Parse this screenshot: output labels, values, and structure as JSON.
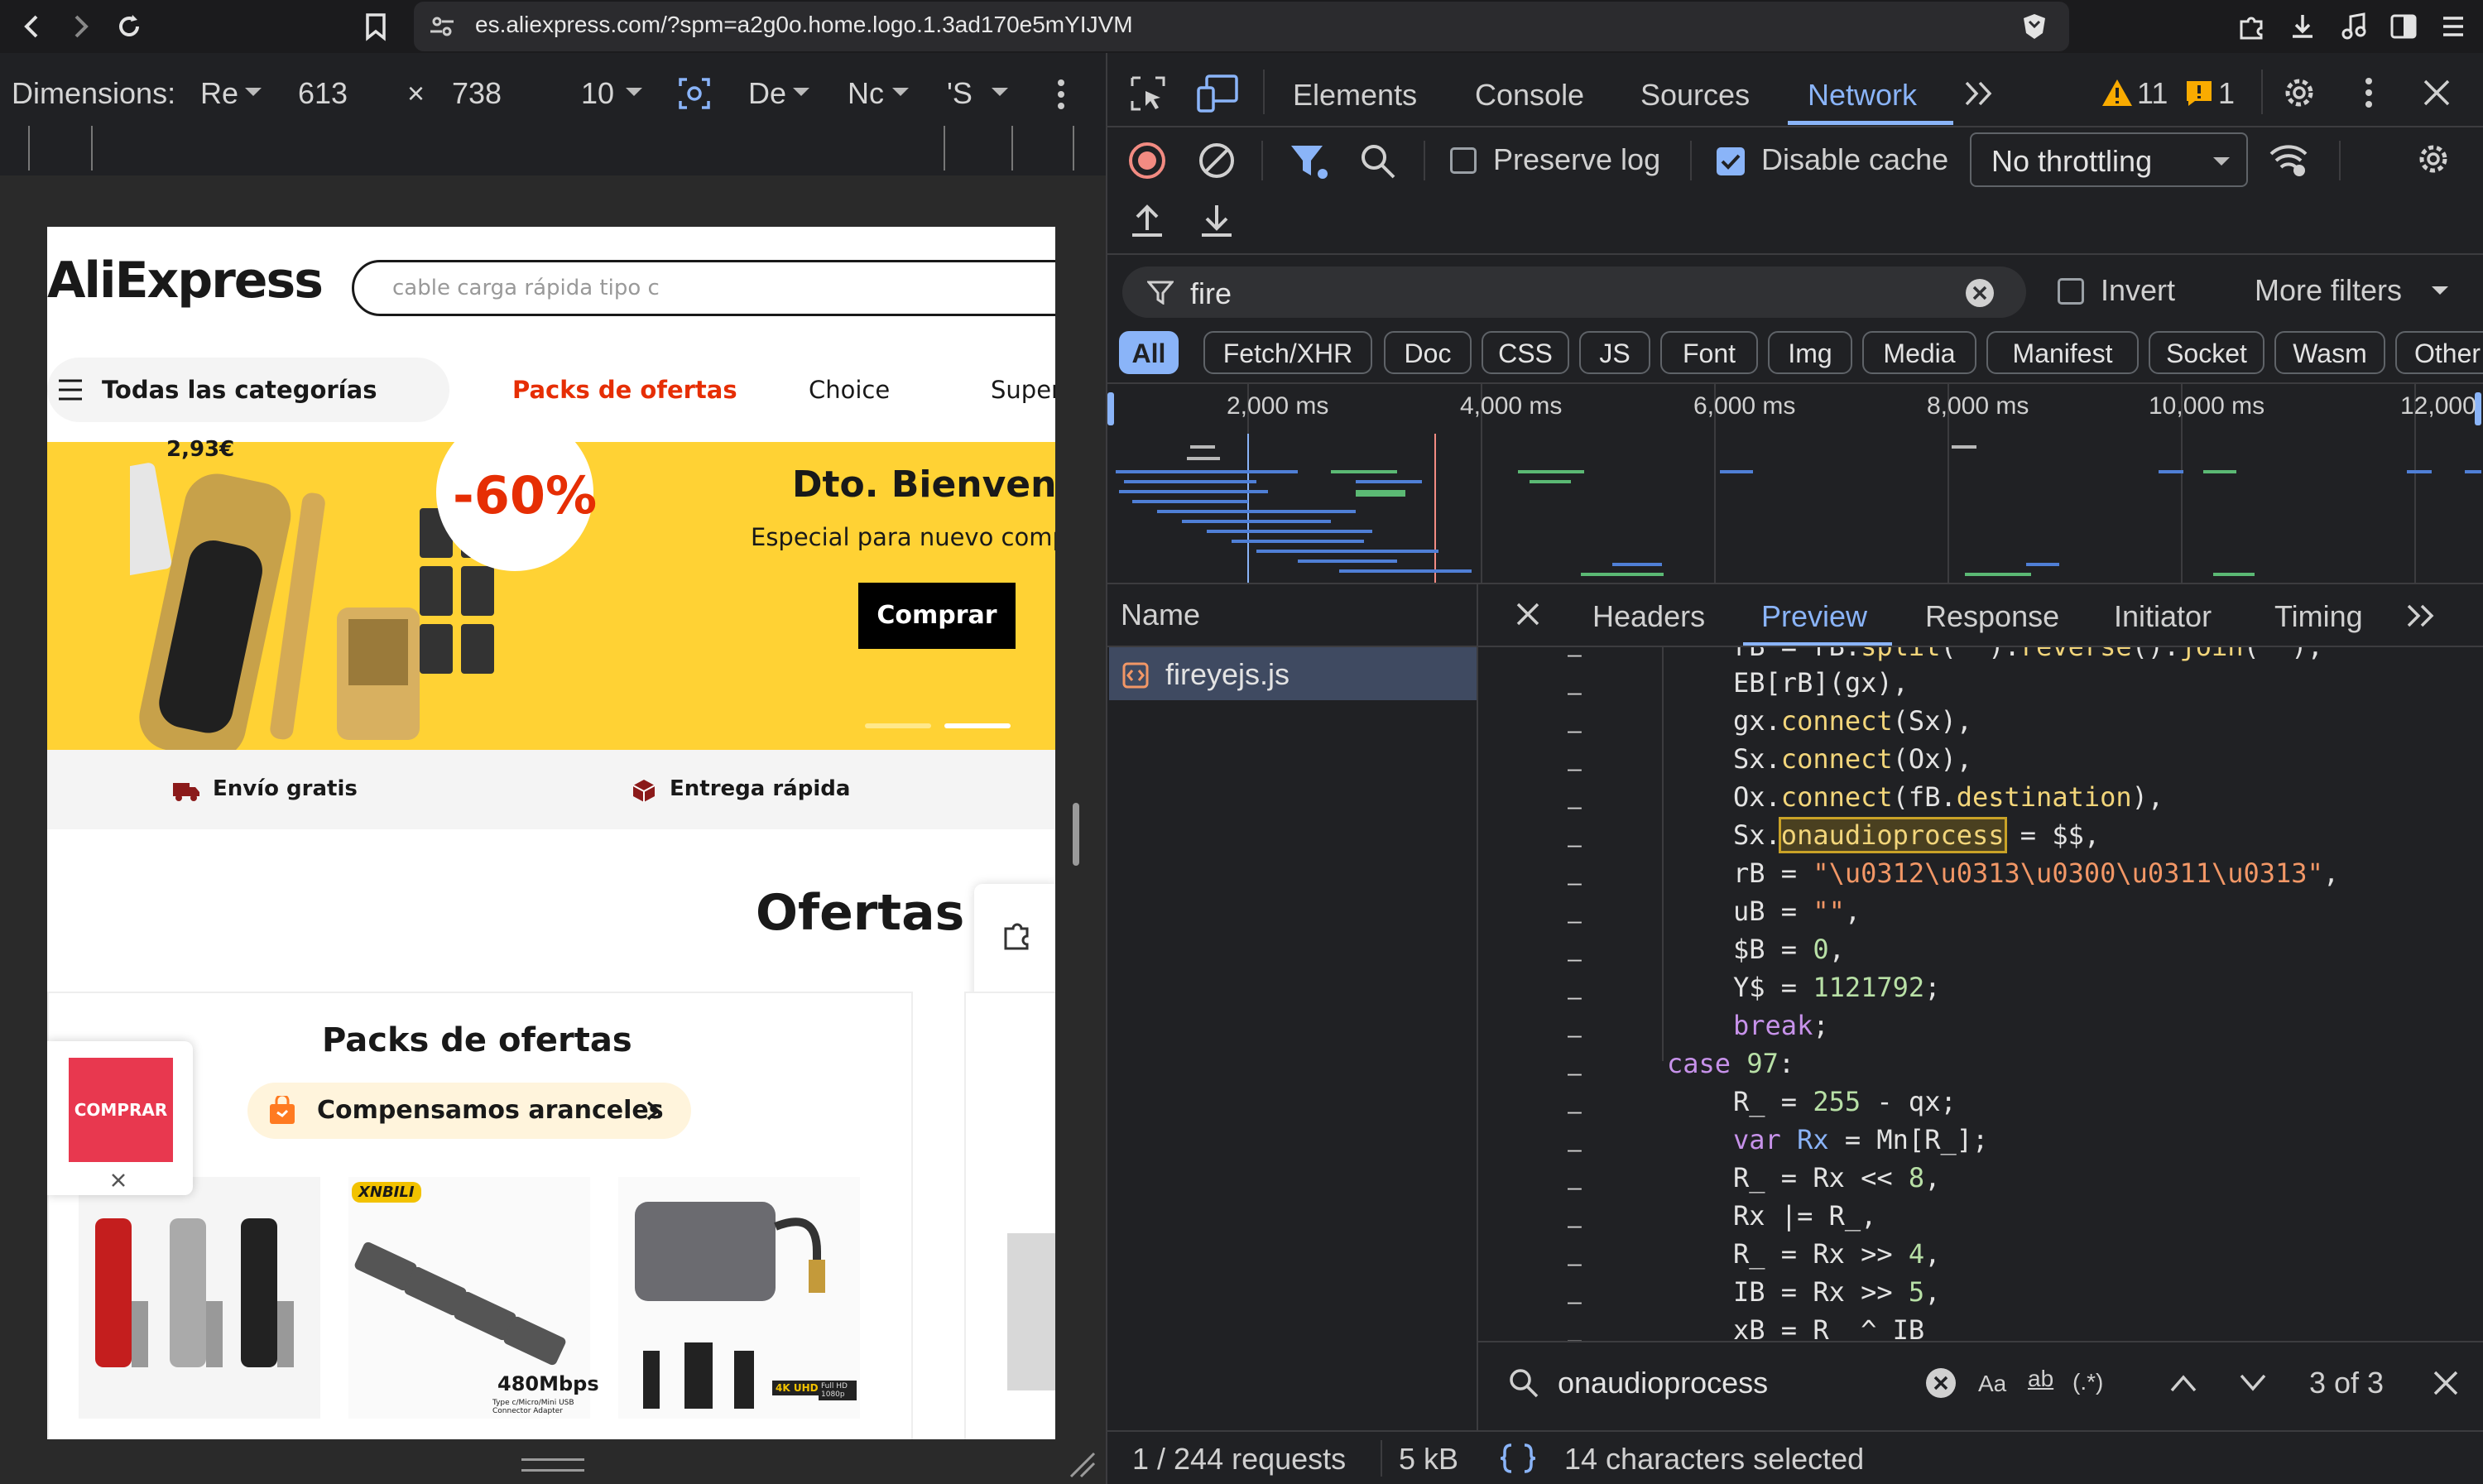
{
  "browser": {
    "url": "es.aliexpress.com/?spm=a2g0o.home.logo.1.3ad170e5mYIJVM"
  },
  "device_toolbar": {
    "dimensions_label": "Dimensions:",
    "device": "Re",
    "width": "613",
    "times": "×",
    "height": "738",
    "zoom": "10",
    "dpr": "De",
    "network": "Nc",
    "ua": "'S"
  },
  "page": {
    "logo": "AliExpress",
    "search_placeholder": "cable carga rápida tipo c",
    "nav_all_categories": "Todas las categorías",
    "nav_packs": "Packs de ofertas",
    "nav_choice": "Choice",
    "nav_super": "Super",
    "banner_price": "2,93€",
    "banner_discount": "-60%",
    "banner_title": "Dto. Bienvenic",
    "banner_subtitle": "Especial para nuevo comp",
    "banner_button": "Comprar",
    "envio_gratis": "Envío gratis",
    "entrega_rapida": "Entrega rápida",
    "section_title": "Ofertas d",
    "card_title": "Packs de ofertas",
    "card_badge": "Compensamos aranceles",
    "floating_buy": "COMPRAR",
    "product2_brand": "XNBILI",
    "product2_speed": "480Mbps",
    "product2_caption": "Type c/Micro/Mini USB Connector Adapter",
    "product3_badge1": "4K UHD",
    "product3_badge2": "Full HD 1080p"
  },
  "devtools": {
    "tabs": [
      "Elements",
      "Console",
      "Sources",
      "Network"
    ],
    "active_tab": "Network",
    "warnings": "11",
    "issues": "1",
    "preserve_log": "Preserve log",
    "disable_cache": "Disable cache",
    "throttling": "No throttling",
    "filter_value": "fire",
    "invert": "Invert",
    "more_filters": "More filters",
    "type_filters": [
      "All",
      "Fetch/XHR",
      "Doc",
      "CSS",
      "JS",
      "Font",
      "Img",
      "Media",
      "Manifest",
      "Socket",
      "Wasm",
      "Other"
    ],
    "timeline_ticks": [
      "2,000 ms",
      "4,000 ms",
      "6,000 ms",
      "8,000 ms",
      "10,000 ms",
      "12,000"
    ],
    "name_header": "Name",
    "request_name": "fireyejs.js",
    "detail_tabs": [
      "Headers",
      "Preview",
      "Response",
      "Initiator",
      "Timing"
    ],
    "active_detail_tab": "Preview",
    "search_query": "onaudioprocess",
    "search_case": "Aa",
    "search_word": "ab",
    "search_regex": "(.*)",
    "search_count": "3 of 3",
    "status_requests": "1 / 244 requests",
    "status_size": "5 kB",
    "status_selection": "14 characters selected",
    "colors": {
      "accent": "#8ab4f8",
      "record": "#f28b82",
      "warning": "#f9ab00",
      "highlight": "#c9a227"
    }
  }
}
